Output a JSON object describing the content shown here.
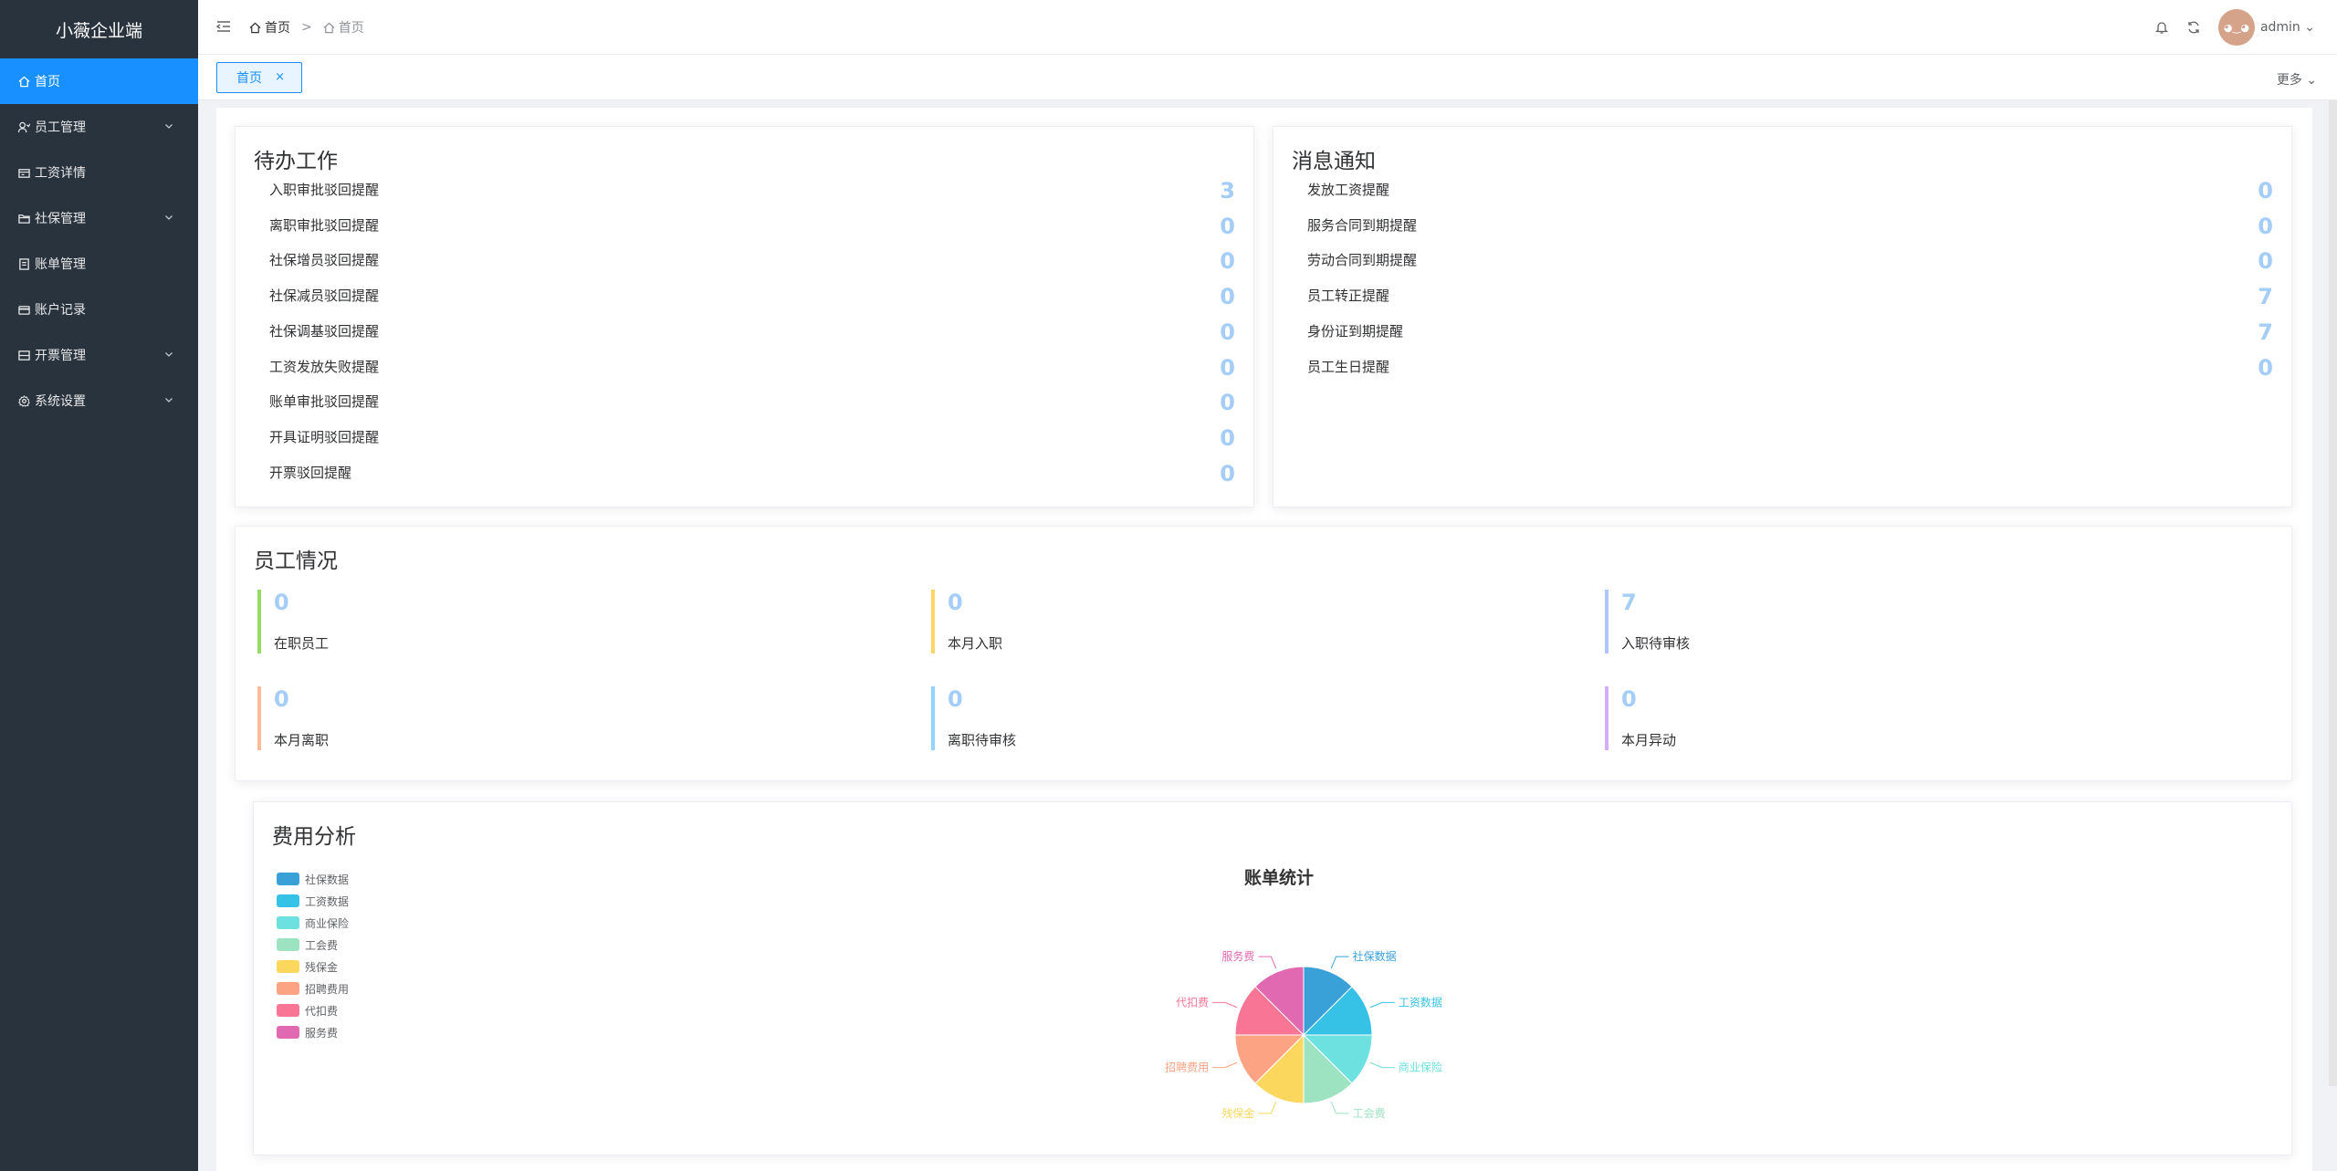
{
  "app": {
    "title": "小薇企业端"
  },
  "sidebar": {
    "items": [
      {
        "label": "首页",
        "icon": "home-icon",
        "active": true,
        "expandable": false
      },
      {
        "label": "员工管理",
        "icon": "user-icon",
        "active": false,
        "expandable": true
      },
      {
        "label": "工资详情",
        "icon": "wallet-icon",
        "active": false,
        "expandable": false
      },
      {
        "label": "社保管理",
        "icon": "folder-icon",
        "active": false,
        "expandable": true
      },
      {
        "label": "账单管理",
        "icon": "document-icon",
        "active": false,
        "expandable": false
      },
      {
        "label": "账户记录",
        "icon": "card-icon",
        "active": false,
        "expandable": false
      },
      {
        "label": "开票管理",
        "icon": "invoice-icon",
        "active": false,
        "expandable": true
      },
      {
        "label": "系统设置",
        "icon": "gear-icon",
        "active": false,
        "expandable": true
      }
    ]
  },
  "header": {
    "breadcrumb": [
      "首页",
      "首页"
    ],
    "username": "admin"
  },
  "tags": {
    "items": [
      {
        "label": "首页",
        "close": "×"
      }
    ],
    "more_label": "更多"
  },
  "todo": {
    "title": "待办工作",
    "rows": [
      {
        "label": "入职审批驳回提醒",
        "value": "3"
      },
      {
        "label": "离职审批驳回提醒",
        "value": "0"
      },
      {
        "label": "社保增员驳回提醒",
        "value": "0"
      },
      {
        "label": "社保减员驳回提醒",
        "value": "0"
      },
      {
        "label": "社保调基驳回提醒",
        "value": "0"
      },
      {
        "label": "工资发放失败提醒",
        "value": "0"
      },
      {
        "label": "账单审批驳回提醒",
        "value": "0"
      },
      {
        "label": "开具证明驳回提醒",
        "value": "0"
      },
      {
        "label": "开票驳回提醒",
        "value": "0"
      }
    ]
  },
  "notice": {
    "title": "消息通知",
    "rows": [
      {
        "label": "发放工资提醒",
        "value": "0"
      },
      {
        "label": "服务合同到期提醒",
        "value": "0"
      },
      {
        "label": "劳动合同到期提醒",
        "value": "0"
      },
      {
        "label": "员工转正提醒",
        "value": "7"
      },
      {
        "label": "身份证到期提醒",
        "value": "7"
      },
      {
        "label": "员工生日提醒",
        "value": "0"
      }
    ]
  },
  "employees": {
    "title": "员工情况",
    "stats": [
      {
        "label": "在职员工",
        "value": "0",
        "color": "#95de64"
      },
      {
        "label": "本月入职",
        "value": "0",
        "color": "#ffd666"
      },
      {
        "label": "入职待审核",
        "value": "7",
        "color": "#adc6ff"
      },
      {
        "label": "本月离职",
        "value": "0",
        "color": "#ffbb96"
      },
      {
        "label": "离职待审核",
        "value": "0",
        "color": "#91d5ff"
      },
      {
        "label": "本月异动",
        "value": "0",
        "color": "#d3adf7"
      }
    ]
  },
  "cost": {
    "title": "费用分析"
  },
  "chart_data": {
    "type": "pie",
    "title": "账单统计",
    "categories": [
      "社保数据",
      "工资数据",
      "商业保险",
      "工会费",
      "残保金",
      "招聘费用",
      "代扣费",
      "服务费"
    ],
    "values": [
      1,
      1,
      1,
      1,
      1,
      1,
      1,
      1
    ],
    "colors": [
      "#3aa1d8",
      "#36c2e6",
      "#6de0e0",
      "#9ee3c1",
      "#fcd75e",
      "#fca384",
      "#f97595",
      "#e069b2"
    ],
    "legend_position": "top-left"
  }
}
